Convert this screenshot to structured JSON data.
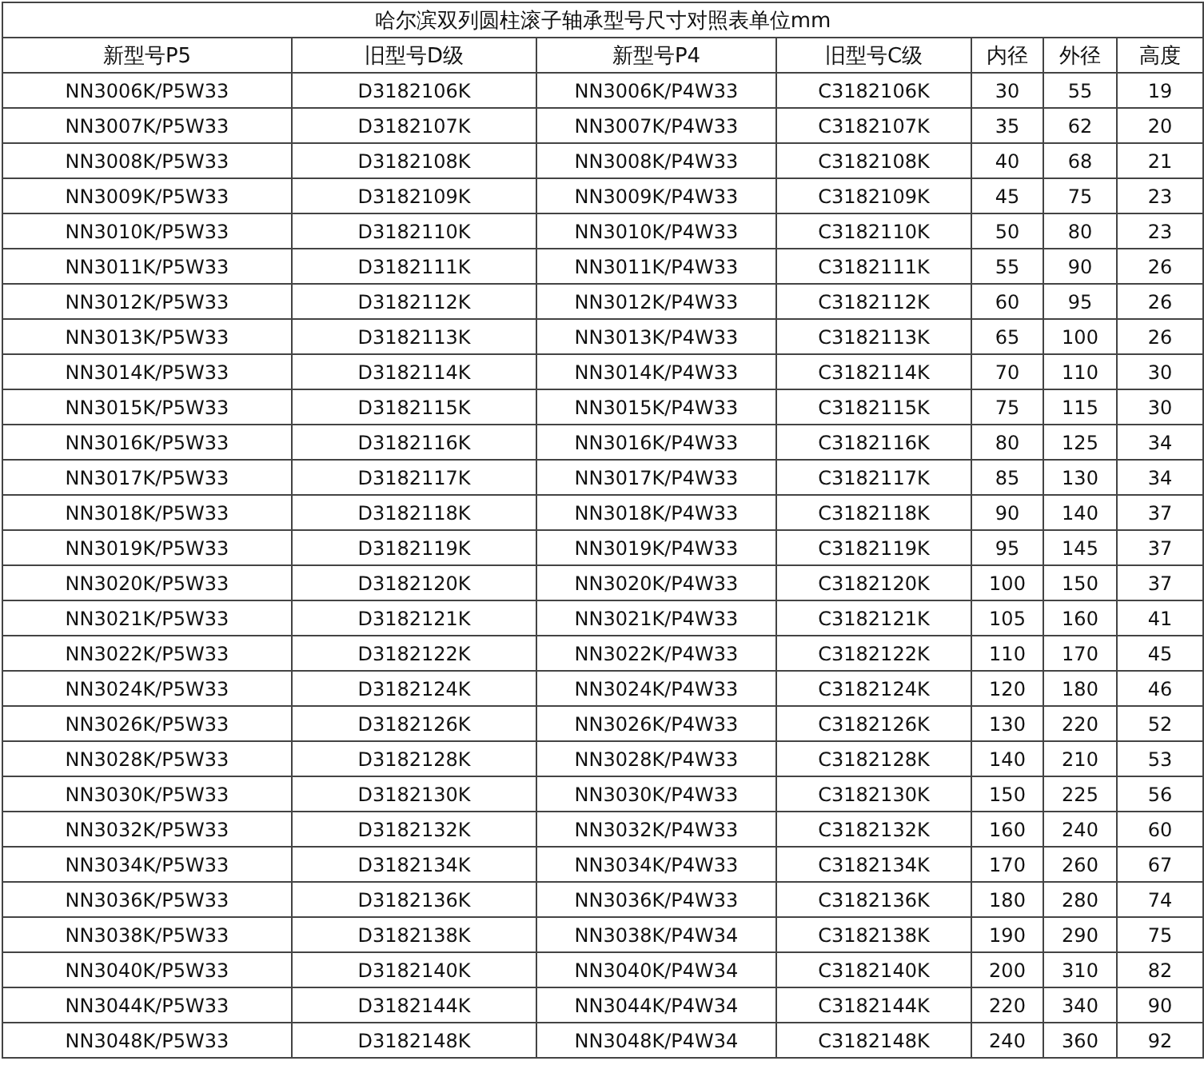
{
  "table": {
    "title": "哈尔滨双列圆柱滚子轴承型号尺寸对照表单位mm",
    "columns": [
      "新型号P5",
      "旧型号D级",
      "新型号P4",
      "旧型号C级",
      "内径",
      "外径",
      "高度"
    ],
    "rows": [
      [
        "NN3006K/P5W33",
        "D3182106K",
        "NN3006K/P4W33",
        "C3182106K",
        "30",
        "55",
        "19"
      ],
      [
        "NN3007K/P5W33",
        "D3182107K",
        "NN3007K/P4W33",
        "C3182107K",
        "35",
        "62",
        "20"
      ],
      [
        "NN3008K/P5W33",
        "D3182108K",
        "NN3008K/P4W33",
        "C3182108K",
        "40",
        "68",
        "21"
      ],
      [
        "NN3009K/P5W33",
        "D3182109K",
        "NN3009K/P4W33",
        "C3182109K",
        "45",
        "75",
        "23"
      ],
      [
        "NN3010K/P5W33",
        "D3182110K",
        "NN3010K/P4W33",
        "C3182110K",
        "50",
        "80",
        "23"
      ],
      [
        "NN3011K/P5W33",
        "D3182111K",
        "NN3011K/P4W33",
        "C3182111K",
        "55",
        "90",
        "26"
      ],
      [
        "NN3012K/P5W33",
        "D3182112K",
        "NN3012K/P4W33",
        "C3182112K",
        "60",
        "95",
        "26"
      ],
      [
        "NN3013K/P5W33",
        "D3182113K",
        "NN3013K/P4W33",
        "C3182113K",
        "65",
        "100",
        "26"
      ],
      [
        "NN3014K/P5W33",
        "D3182114K",
        "NN3014K/P4W33",
        "C3182114K",
        "70",
        "110",
        "30"
      ],
      [
        "NN3015K/P5W33",
        "D3182115K",
        "NN3015K/P4W33",
        "C3182115K",
        "75",
        "115",
        "30"
      ],
      [
        "NN3016K/P5W33",
        "D3182116K",
        "NN3016K/P4W33",
        "C3182116K",
        "80",
        "125",
        "34"
      ],
      [
        "NN3017K/P5W33",
        "D3182117K",
        "NN3017K/P4W33",
        "C3182117K",
        "85",
        "130",
        "34"
      ],
      [
        "NN3018K/P5W33",
        "D3182118K",
        "NN3018K/P4W33",
        "C3182118K",
        "90",
        "140",
        "37"
      ],
      [
        "NN3019K/P5W33",
        "D3182119K",
        "NN3019K/P4W33",
        "C3182119K",
        "95",
        "145",
        "37"
      ],
      [
        "NN3020K/P5W33",
        "D3182120K",
        "NN3020K/P4W33",
        "C3182120K",
        "100",
        "150",
        "37"
      ],
      [
        "NN3021K/P5W33",
        "D3182121K",
        "NN3021K/P4W33",
        "C3182121K",
        "105",
        "160",
        "41"
      ],
      [
        "NN3022K/P5W33",
        "D3182122K",
        "NN3022K/P4W33",
        "C3182122K",
        "110",
        "170",
        "45"
      ],
      [
        "NN3024K/P5W33",
        "D3182124K",
        "NN3024K/P4W33",
        "C3182124K",
        "120",
        "180",
        "46"
      ],
      [
        "NN3026K/P5W33",
        "D3182126K",
        "NN3026K/P4W33",
        "C3182126K",
        "130",
        "220",
        "52"
      ],
      [
        "NN3028K/P5W33",
        "D3182128K",
        "NN3028K/P4W33",
        "C3182128K",
        "140",
        "210",
        "53"
      ],
      [
        "NN3030K/P5W33",
        "D3182130K",
        "NN3030K/P4W33",
        "C3182130K",
        "150",
        "225",
        "56"
      ],
      [
        "NN3032K/P5W33",
        "D3182132K",
        "NN3032K/P4W33",
        "C3182132K",
        "160",
        "240",
        "60"
      ],
      [
        "NN3034K/P5W33",
        "D3182134K",
        "NN3034K/P4W33",
        "C3182134K",
        "170",
        "260",
        "67"
      ],
      [
        "NN3036K/P5W33",
        "D3182136K",
        "NN3036K/P4W33",
        "C3182136K",
        "180",
        "280",
        "74"
      ],
      [
        "NN3038K/P5W33",
        "D3182138K",
        "NN3038K/P4W34",
        "C3182138K",
        "190",
        "290",
        "75"
      ],
      [
        "NN3040K/P5W33",
        "D3182140K",
        "NN3040K/P4W34",
        "C3182140K",
        "200",
        "310",
        "82"
      ],
      [
        "NN3044K/P5W33",
        "D3182144K",
        "NN3044K/P4W34",
        "C3182144K",
        "220",
        "340",
        "90"
      ],
      [
        "NN3048K/P5W33",
        "D3182148K",
        "NN3048K/P4W34",
        "C3182148K",
        "240",
        "360",
        "92"
      ]
    ]
  }
}
